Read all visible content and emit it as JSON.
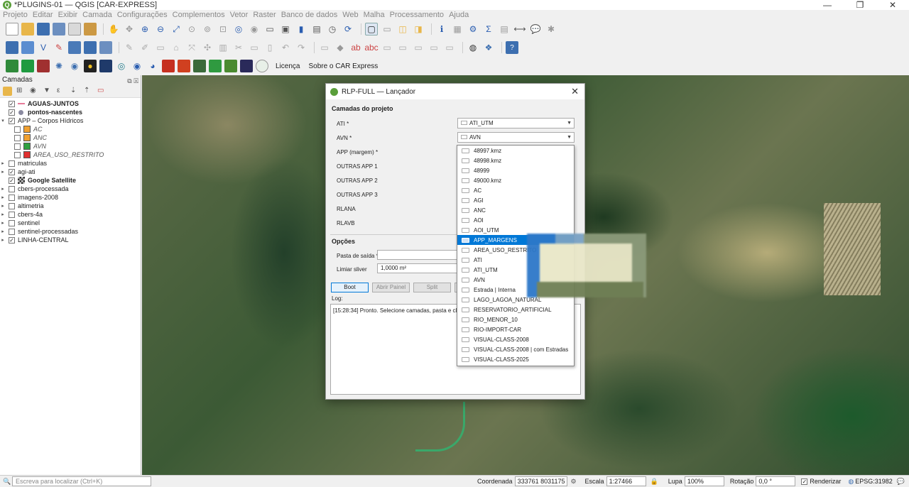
{
  "window": {
    "title": "*PLUGINS-01 — QGIS [CAR-EXPRESS]",
    "controls": [
      "—",
      "❐",
      "✕"
    ]
  },
  "menu": [
    "Projeto",
    "Editar",
    "Exibir",
    "Camada",
    "Configurações",
    "Complementos",
    "Vetor",
    "Raster",
    "Banco de dados",
    "Web",
    "Malha",
    "Processamento",
    "Ajuda"
  ],
  "toolbar3": {
    "licenca": "Licença",
    "sobre": "Sobre o CAR Express"
  },
  "layers_panel": {
    "title": "Camadas",
    "items": [
      {
        "label": "AGUAS-JUNTOS",
        "checked": true,
        "style": "bold",
        "expand": "",
        "symbol": "line",
        "color": "#e87b9a"
      },
      {
        "label": "pontos-nascentes",
        "checked": true,
        "style": "bold",
        "expand": "",
        "symbol": "point",
        "color": "#8a8aa0"
      },
      {
        "label": "APP – Corpos Hídricos",
        "checked": true,
        "style": "normal",
        "expand": "▾",
        "symbol": "none",
        "color": ""
      },
      {
        "label": "AC",
        "checked": false,
        "style": "italic",
        "expand": "",
        "symbol": "fill",
        "color": "#f0a030",
        "indent": true
      },
      {
        "label": "ANC",
        "checked": false,
        "style": "italic",
        "expand": "",
        "symbol": "fill",
        "color": "#f0a030",
        "indent": true
      },
      {
        "label": "AVN",
        "checked": false,
        "style": "italic",
        "expand": "",
        "symbol": "fill",
        "color": "#2fa040",
        "indent": true
      },
      {
        "label": "AREA_USO_RESTRITO",
        "checked": false,
        "style": "italic",
        "expand": "",
        "symbol": "fill",
        "color": "#e03030",
        "indent": true
      },
      {
        "label": "matriculas",
        "checked": false,
        "style": "normal",
        "expand": "▸",
        "symbol": "none",
        "color": ""
      },
      {
        "label": "agi-ati",
        "checked": true,
        "style": "normal",
        "expand": "▸",
        "symbol": "none",
        "color": ""
      },
      {
        "label": "Google Satellite",
        "checked": true,
        "style": "bold",
        "expand": "",
        "symbol": "raster",
        "color": "#555"
      },
      {
        "label": "cbers-processada",
        "checked": false,
        "style": "normal",
        "expand": "▸",
        "symbol": "none",
        "color": ""
      },
      {
        "label": "imagens-2008",
        "checked": false,
        "style": "normal",
        "expand": "▸",
        "symbol": "none",
        "color": ""
      },
      {
        "label": "altimetria",
        "checked": false,
        "style": "normal",
        "expand": "▸",
        "symbol": "none",
        "color": ""
      },
      {
        "label": "cbers-4a",
        "checked": false,
        "style": "normal",
        "expand": "▸",
        "symbol": "none",
        "color": ""
      },
      {
        "label": "sentinel",
        "checked": false,
        "style": "normal",
        "expand": "▸",
        "symbol": "none",
        "color": ""
      },
      {
        "label": "sentinel-processadas",
        "checked": false,
        "style": "normal",
        "expand": "▸",
        "symbol": "none",
        "color": ""
      },
      {
        "label": "LINHA-CENTRAL",
        "checked": true,
        "style": "normal",
        "expand": "▸",
        "symbol": "none",
        "color": ""
      }
    ]
  },
  "dialog": {
    "title": "RLP-FULL — Lançador",
    "section_layers": "Camadas do projeto",
    "fields": {
      "ati": {
        "label": "ATI *",
        "value": "ATI_UTM"
      },
      "avn": {
        "label": "AVN *",
        "value": "AVN"
      },
      "app": {
        "label": "APP (margem) *"
      },
      "outras1": {
        "label": "OUTRAS APP 1"
      },
      "outras2": {
        "label": "OUTRAS APP 2"
      },
      "outras3": {
        "label": "OUTRAS APP 3"
      },
      "rlana": {
        "label": "RLANA"
      },
      "rlavb": {
        "label": "RLAVB"
      }
    },
    "section_options": "Opções",
    "pasta": {
      "label": "Pasta de saída *",
      "value": ""
    },
    "limiar": {
      "label": "Limiar sliver",
      "value": "1,0000 m²"
    },
    "buttons": {
      "boot": "Boot",
      "abrir": "Abrir Painel",
      "split": "Split"
    },
    "log_label": "Log:",
    "log_text": "[15:28:34] Pronto. Selecione camadas, pasta e clique B"
  },
  "dropdown": {
    "selected_index": 9,
    "items": [
      "48997.kmz",
      "48998.kmz",
      "48999",
      "49000.kmz",
      "AC",
      "AGI",
      "ANC",
      "AOI",
      "AOI_UTM",
      "APP_MARGENS",
      "AREA_USO_RESTRITO",
      "ATI",
      "ATI_UTM",
      "AVN",
      "Estrada | Interna",
      "LAGO_LAGOA_NATURAL",
      "RESERVATORIO_ARTIFICIAL",
      "RIO_MENOR_10",
      "RIO-IMPORT-CAR",
      "VISUAL-CLASS-2008",
      "VISUAL-CLASS-2008 | com Estradas",
      "VISUAL-CLASS-2025"
    ]
  },
  "statusbar": {
    "locator_placeholder": "Escreva para localizar (Ctrl+K)",
    "coord_label": "Coordenada",
    "coord_value": "333761 8031175",
    "scale_label": "Escala",
    "scale_value": "1:27466",
    "lupa_label": "Lupa",
    "lupa_value": "100%",
    "rot_label": "Rotação",
    "rot_value": "0,0 °",
    "render_label": "Renderizar",
    "epsg": "EPSG:31982"
  }
}
